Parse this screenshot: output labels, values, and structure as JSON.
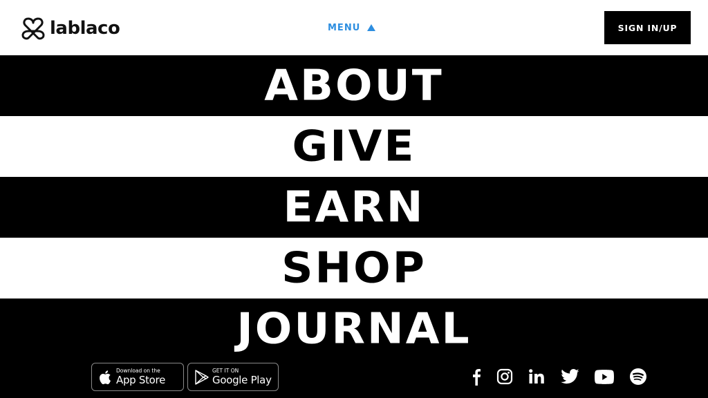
{
  "header": {
    "logo_text": "lablaco",
    "menu_label": "MENU",
    "signin_label": "SIGN IN/UP",
    "accent_color": "#2d8ee0"
  },
  "nav": {
    "items": [
      {
        "label": "ABOUT",
        "theme": "dark"
      },
      {
        "label": "GIVE",
        "theme": "light"
      },
      {
        "label": "EARN",
        "theme": "dark"
      },
      {
        "label": "SHOP",
        "theme": "light"
      },
      {
        "label": "JOURNAL",
        "theme": "dark"
      }
    ]
  },
  "footer": {
    "app_store": {
      "small": "Download on the",
      "big": "App Store",
      "icon": "apple-icon"
    },
    "google_play": {
      "small": "GET IT ON",
      "big": "Google Play",
      "icon": "google-play-icon"
    },
    "socials": [
      "facebook-icon",
      "instagram-icon",
      "linkedin-icon",
      "twitter-icon",
      "youtube-icon",
      "spotify-icon"
    ]
  }
}
